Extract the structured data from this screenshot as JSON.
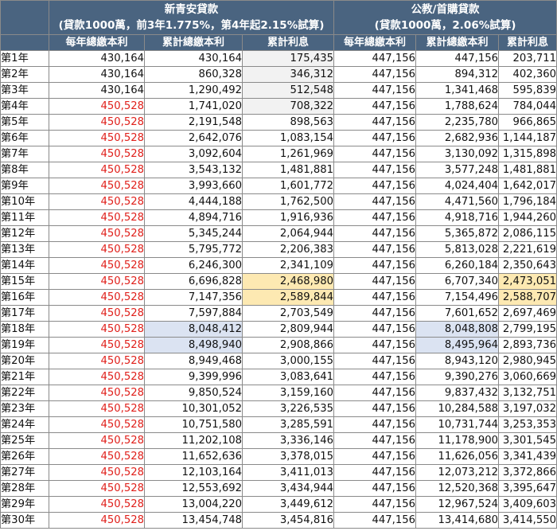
{
  "table": {
    "group_left_title": "新青安貸款",
    "group_left_subtitle": "(貸款1000萬，前3年1.775%，第4年起2.15%試算)",
    "group_right_title": "公教/首購貸款",
    "group_right_subtitle": "(貸款1000萬，2.06%試算)",
    "columns": [
      "每年總繳本利",
      "累計總繳本利",
      "累計利息",
      "每年總繳本利",
      "累計總繳本利",
      "累計利息"
    ],
    "highlight_colors": {
      "yellow": "#fde9b2",
      "blue": "#dbe3f2",
      "gray": "#f2f2f2",
      "red_text": "#e0201b",
      "header_bg": "#4a6480"
    },
    "rows": [
      {
        "year": "第1年",
        "a1": "430,164",
        "a2": "430,164",
        "a3": "175,435",
        "b1": "447,156",
        "b2": "447,156",
        "b3": "203,711",
        "a1_red": false,
        "a3_hl": "gray"
      },
      {
        "year": "第2年",
        "a1": "430,164",
        "a2": "860,328",
        "a3": "346,312",
        "b1": "447,156",
        "b2": "894,312",
        "b3": "402,360",
        "a1_red": false,
        "a3_hl": "gray"
      },
      {
        "year": "第3年",
        "a1": "430,164",
        "a2": "1,290,492",
        "a3": "512,548",
        "b1": "447,156",
        "b2": "1,341,468",
        "b3": "595,839",
        "a1_red": false,
        "a3_hl": "gray"
      },
      {
        "year": "第4年",
        "a1": "450,528",
        "a2": "1,741,020",
        "a3": "708,322",
        "b1": "447,156",
        "b2": "1,788,624",
        "b3": "784,044",
        "a1_red": true,
        "a3_hl": "gray"
      },
      {
        "year": "第5年",
        "a1": "450,528",
        "a2": "2,191,548",
        "a3": "898,563",
        "b1": "447,156",
        "b2": "2,235,780",
        "b3": "966,865",
        "a1_red": true
      },
      {
        "year": "第6年",
        "a1": "450,528",
        "a2": "2,642,076",
        "a3": "1,083,154",
        "b1": "447,156",
        "b2": "2,682,936",
        "b3": "1,144,187",
        "a1_red": true
      },
      {
        "year": "第7年",
        "a1": "450,528",
        "a2": "3,092,604",
        "a3": "1,261,969",
        "b1": "447,156",
        "b2": "3,130,092",
        "b3": "1,315,898",
        "a1_red": true
      },
      {
        "year": "第8年",
        "a1": "450,528",
        "a2": "3,543,132",
        "a3": "1,481,881",
        "b1": "447,156",
        "b2": "3,577,248",
        "b3": "1,481,881",
        "a1_red": true
      },
      {
        "year": "第9年",
        "a1": "450,528",
        "a2": "3,993,660",
        "a3": "1,601,772",
        "b1": "447,156",
        "b2": "4,024,404",
        "b3": "1,642,017",
        "a1_red": true
      },
      {
        "year": "第10年",
        "a1": "450,528",
        "a2": "4,444,188",
        "a3": "1,762,500",
        "b1": "447,156",
        "b2": "4,471,560",
        "b3": "1,796,184",
        "a1_red": true
      },
      {
        "year": "第11年",
        "a1": "450,528",
        "a2": "4,894,716",
        "a3": "1,916,936",
        "b1": "447,156",
        "b2": "4,918,716",
        "b3": "1,944,260",
        "a1_red": true
      },
      {
        "year": "第12年",
        "a1": "450,528",
        "a2": "5,345,244",
        "a3": "2,064,944",
        "b1": "447,156",
        "b2": "5,365,872",
        "b3": "2,086,115",
        "a1_red": true
      },
      {
        "year": "第13年",
        "a1": "450,528",
        "a2": "5,795,772",
        "a3": "2,206,383",
        "b1": "447,156",
        "b2": "5,813,028",
        "b3": "2,221,619",
        "a1_red": true
      },
      {
        "year": "第14年",
        "a1": "450,528",
        "a2": "6,246,300",
        "a3": "2,341,109",
        "b1": "447,156",
        "b2": "6,260,184",
        "b3": "2,350,643",
        "a1_red": true
      },
      {
        "year": "第15年",
        "a1": "450,528",
        "a2": "6,696,828",
        "a3": "2,468,980",
        "b1": "447,156",
        "b2": "6,707,340",
        "b3": "2,473,051",
        "a1_red": true,
        "a3_hl": "yellow",
        "b3_hl": "yellow"
      },
      {
        "year": "第16年",
        "a1": "450,528",
        "a2": "7,147,356",
        "a3": "2,589,844",
        "b1": "447,156",
        "b2": "7,154,496",
        "b3": "2,588,707",
        "a1_red": true,
        "a3_hl": "yellow",
        "b3_hl": "yellow"
      },
      {
        "year": "第17年",
        "a1": "450,528",
        "a2": "7,597,884",
        "a3": "2,703,549",
        "b1": "447,156",
        "b2": "7,601,652",
        "b3": "2,697,469",
        "a1_red": true
      },
      {
        "year": "第18年",
        "a1": "450,528",
        "a2": "8,048,412",
        "a3": "2,809,944",
        "b1": "447,156",
        "b2": "8,048,808",
        "b3": "2,799,195",
        "a1_red": true,
        "a2_hl": "blue",
        "b2_hl": "blue"
      },
      {
        "year": "第19年",
        "a1": "450,528",
        "a2": "8,498,940",
        "a3": "2,908,866",
        "b1": "447,156",
        "b2": "8,495,964",
        "b3": "2,893,736",
        "a1_red": true,
        "a2_hl": "blue",
        "b2_hl": "blue"
      },
      {
        "year": "第20年",
        "a1": "450,528",
        "a2": "8,949,468",
        "a3": "3,000,155",
        "b1": "447,156",
        "b2": "8,943,120",
        "b3": "2,980,945",
        "a1_red": true
      },
      {
        "year": "第21年",
        "a1": "450,528",
        "a2": "9,399,996",
        "a3": "3,083,641",
        "b1": "447,156",
        "b2": "9,390,276",
        "b3": "3,060,669",
        "a1_red": true
      },
      {
        "year": "第22年",
        "a1": "450,528",
        "a2": "9,850,524",
        "a3": "3,159,160",
        "b1": "447,156",
        "b2": "9,837,432",
        "b3": "3,132,751",
        "a1_red": true
      },
      {
        "year": "第23年",
        "a1": "450,528",
        "a2": "10,301,052",
        "a3": "3,226,535",
        "b1": "447,156",
        "b2": "10,284,588",
        "b3": "3,197,032",
        "a1_red": true
      },
      {
        "year": "第24年",
        "a1": "450,528",
        "a2": "10,751,580",
        "a3": "3,285,591",
        "b1": "447,156",
        "b2": "10,731,744",
        "b3": "3,253,353",
        "a1_red": true
      },
      {
        "year": "第25年",
        "a1": "450,528",
        "a2": "11,202,108",
        "a3": "3,336,146",
        "b1": "447,156",
        "b2": "11,178,900",
        "b3": "3,301,545",
        "a1_red": true
      },
      {
        "year": "第26年",
        "a1": "450,528",
        "a2": "11,652,636",
        "a3": "3,378,015",
        "b1": "447,156",
        "b2": "11,626,056",
        "b3": "3,341,439",
        "a1_red": true
      },
      {
        "year": "第27年",
        "a1": "450,528",
        "a2": "12,103,164",
        "a3": "3,411,013",
        "b1": "447,156",
        "b2": "12,073,212",
        "b3": "3,372,866",
        "a1_red": true
      },
      {
        "year": "第28年",
        "a1": "450,528",
        "a2": "12,553,692",
        "a3": "3,434,944",
        "b1": "447,156",
        "b2": "12,520,368",
        "b3": "3,395,647",
        "a1_red": true
      },
      {
        "year": "第29年",
        "a1": "450,528",
        "a2": "13,004,220",
        "a3": "3,449,612",
        "b1": "447,156",
        "b2": "12,967,524",
        "b3": "3,409,603",
        "a1_red": true
      },
      {
        "year": "第30年",
        "a1": "450,528",
        "a2": "13,454,748",
        "a3": "3,454,816",
        "b1": "447,156",
        "b2": "13,414,680",
        "b3": "3,414,550",
        "a1_red": true
      }
    ]
  }
}
